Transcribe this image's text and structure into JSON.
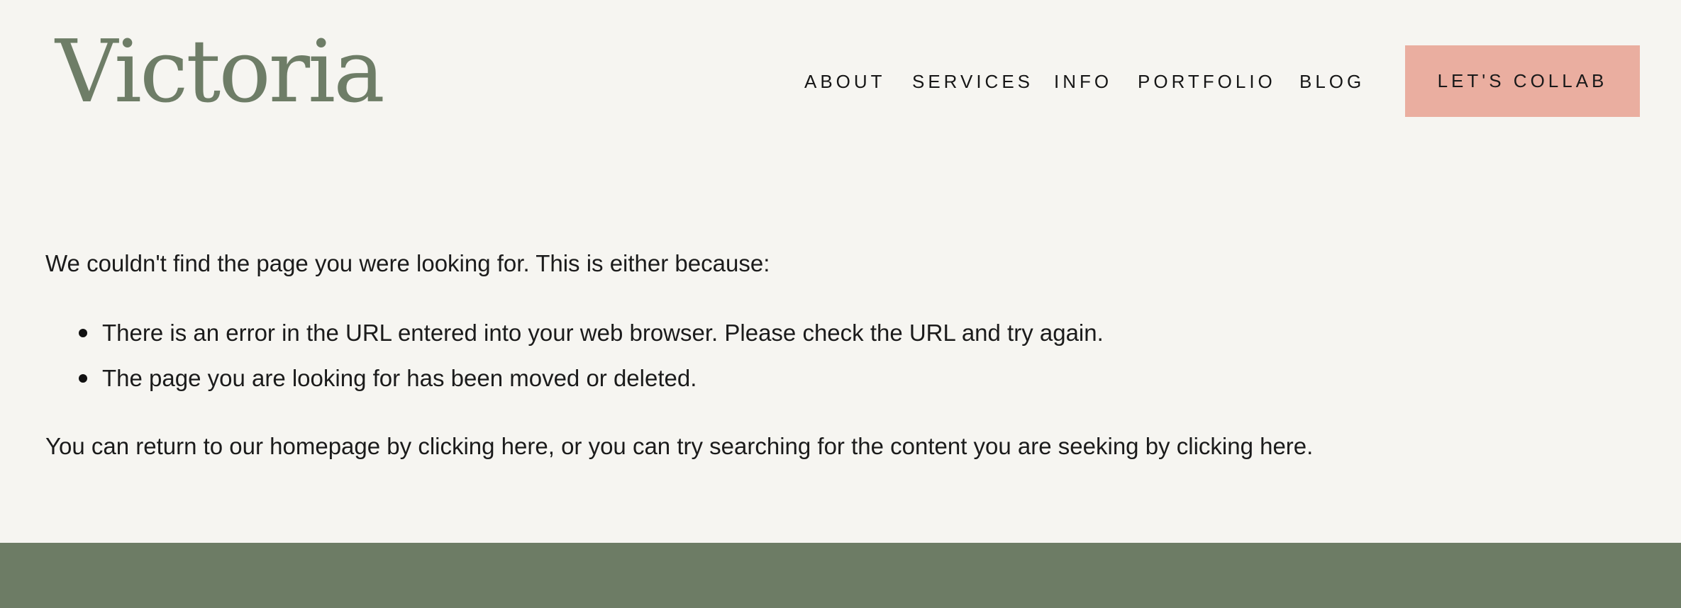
{
  "header": {
    "logo": "Victoria",
    "nav": [
      {
        "label": "ABOUT"
      },
      {
        "label": "SERVICES"
      },
      {
        "label": "INFO"
      },
      {
        "label": "PORTFOLIO"
      },
      {
        "label": "BLOG"
      }
    ],
    "cta_label": "LET'S COLLAB"
  },
  "main": {
    "intro": "We couldn't find the page you were looking for. This is either because:",
    "reasons": [
      "There is an error in the URL entered into your web browser. Please check the URL and try again.",
      "The page you are looking for has been moved or deleted."
    ],
    "outro": {
      "part1": "You can return to our homepage by ",
      "link1": "clicking here",
      "part2": ", or you can try searching for the content you are seeking by ",
      "link2": "clicking here",
      "part3": "."
    }
  },
  "colors": {
    "background": "#f6f5f1",
    "brand_green": "#6e7d67",
    "cta_pink": "#eaaea0",
    "footer": "#6d7c65"
  }
}
